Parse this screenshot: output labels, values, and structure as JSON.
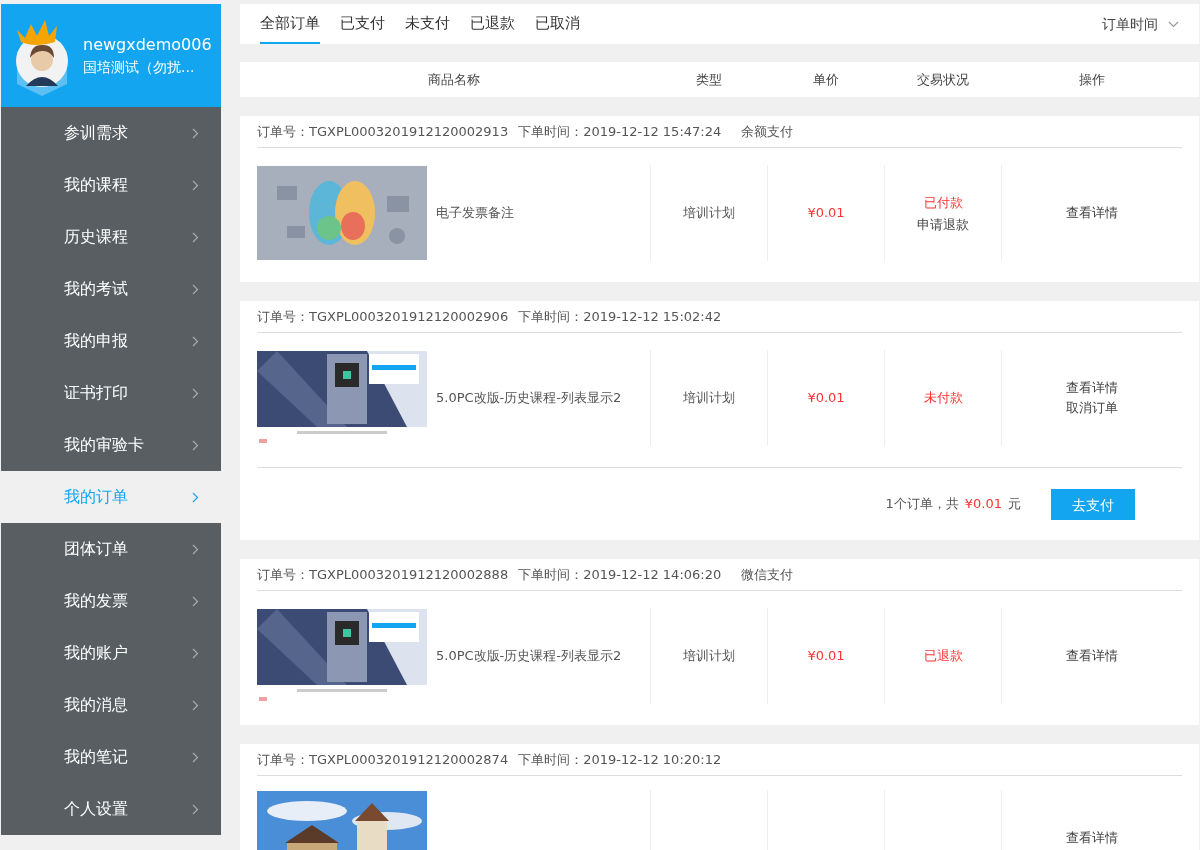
{
  "user": {
    "name": "newgxdemo006",
    "org": "国培测试（勿扰..."
  },
  "menu": [
    {
      "label": "参训需求",
      "selected": false
    },
    {
      "label": "我的课程",
      "selected": false
    },
    {
      "label": "历史课程",
      "selected": false
    },
    {
      "label": "我的考试",
      "selected": false
    },
    {
      "label": "我的申报",
      "selected": false
    },
    {
      "label": "证书打印",
      "selected": false
    },
    {
      "label": "我的审验卡",
      "selected": false
    },
    {
      "label": "我的订单",
      "selected": true
    },
    {
      "label": "团体订单",
      "selected": false
    },
    {
      "label": "我的发票",
      "selected": false
    },
    {
      "label": "我的账户",
      "selected": false
    },
    {
      "label": "我的消息",
      "selected": false
    },
    {
      "label": "我的笔记",
      "selected": false
    },
    {
      "label": "个人设置",
      "selected": false
    }
  ],
  "tabs": [
    {
      "label": "全部订单",
      "selected": true
    },
    {
      "label": "已支付",
      "selected": false
    },
    {
      "label": "未支付",
      "selected": false
    },
    {
      "label": "已退款",
      "selected": false
    },
    {
      "label": "已取消",
      "selected": false
    }
  ],
  "sort": {
    "label": "订单时间"
  },
  "columns": [
    "商品名称",
    "类型",
    "单价",
    "交易状况",
    "操作"
  ],
  "orders": [
    {
      "number": "订单号：TGXPL0003201912120002913",
      "time": "下单时间：2019-12-12 15:47:24",
      "payment": "余额支付",
      "image": {
        "kind": "picture"
      },
      "title": "电子发票备注",
      "type": "培训计划",
      "price": "¥0.01",
      "status": "已付款",
      "status_action": "申请退款",
      "actions": [
        "查看详情"
      ]
    },
    {
      "number": "订单号：TGXPL0003201912120002906",
      "time": "下单时间：2019-12-12 15:02:42",
      "image": {
        "kind": "picture"
      },
      "title": "5.0PC改版-历史课程-列表显示2",
      "type": "培训计划",
      "price": "¥0.01",
      "status": "未付款",
      "actions": [
        "查看详情",
        "取消订单"
      ],
      "footer": {
        "count": "1个订单，共",
        "amount": "¥0.01",
        "unit": "元",
        "button": "去支付"
      }
    },
    {
      "number": "订单号：TGXPL0003201912120002888",
      "time": "下单时间：2019-12-12 14:06:20",
      "payment": "微信支付",
      "image": {
        "kind": "picture"
      },
      "title": "5.0PC改版-历史课程-列表显示2",
      "type": "培训计划",
      "price": "¥0.01",
      "status": "已退款",
      "actions": [
        "查看详情"
      ]
    },
    {
      "number": "订单号：TGXPL0003201912120002874",
      "time": "下单时间：2019-12-12 10:20:12",
      "image": {
        "kind": "picture"
      },
      "actions": [
        "查看详情"
      ]
    }
  ]
}
